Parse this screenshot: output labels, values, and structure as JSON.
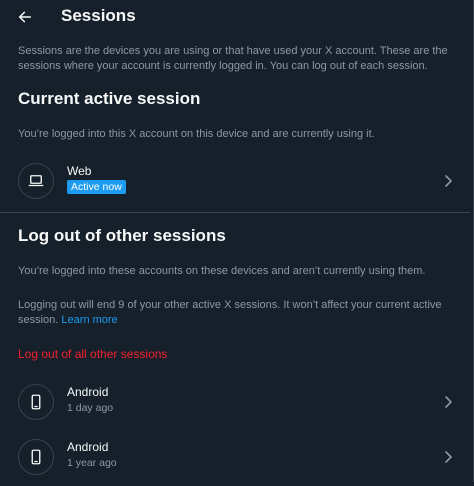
{
  "header": {
    "title": "Sessions"
  },
  "intro": "Sessions are the devices you are using or that have used your X account. These are the sessions where your account is currently logged in. You can log out of each session.",
  "current": {
    "heading": "Current active session",
    "description": "You’re logged into this X account on this device and are currently using it.",
    "session": {
      "device": "Web",
      "badge": "Active now",
      "icon": "laptop-icon"
    }
  },
  "others": {
    "heading": "Log out of other sessions",
    "description": "You’re logged into these accounts on these devices and aren’t currently using them.",
    "note": "Logging out will end 9 of your other active X sessions. It won’t affect your current active session.",
    "learn_more": "Learn more",
    "logout_all": "Log out of all other sessions",
    "sessions": [
      {
        "device": "Android",
        "time": "1 day ago",
        "icon": "phone-icon"
      },
      {
        "device": "Android",
        "time": "1 year ago",
        "icon": "phone-icon"
      }
    ]
  },
  "colors": {
    "background": "#15202b",
    "text_primary": "#f7f9f9",
    "text_secondary": "#8b98a5",
    "accent": "#1d9bf0",
    "danger": "#f4212e",
    "border": "#38444d"
  }
}
